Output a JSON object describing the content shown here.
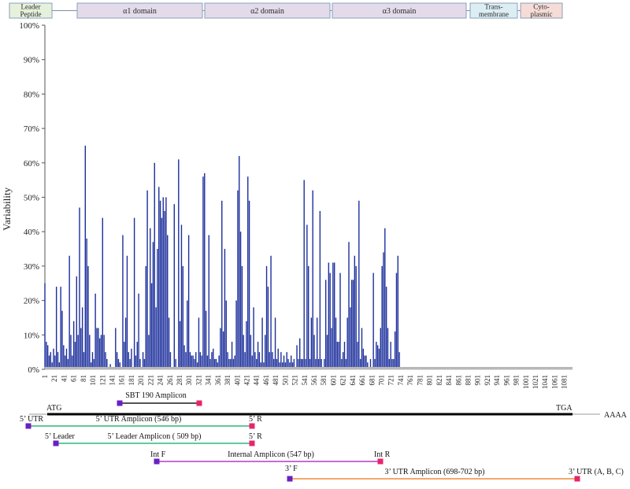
{
  "domains": [
    {
      "label": "Leader\nPeptide",
      "fill": "#e6f1dc"
    },
    {
      "label": "α1 domain",
      "fill": "#e3dbe9"
    },
    {
      "label": "α2 domain",
      "fill": "#e3dbe9"
    },
    {
      "label": "α3 domain",
      "fill": "#e3dbe9"
    },
    {
      "label": "Trans-\nmembrane",
      "fill": "#dceef4"
    },
    {
      "label": "Cyto-\nplasmic",
      "fill": "#f5dcd6"
    }
  ],
  "chart_data": {
    "type": "bar",
    "ylabel": "Variability",
    "xlabel": "",
    "ylim": [
      0,
      100
    ],
    "y_ticks": [
      "0%",
      "10%",
      "20%",
      "30%",
      "40%",
      "50%",
      "60%",
      "70%",
      "80%",
      "90%",
      "100%"
    ],
    "x_ticks": [
      "1",
      "21",
      "41",
      "61",
      "81",
      "101",
      "121",
      "141",
      "161",
      "181",
      "201",
      "221",
      "241",
      "261",
      "281",
      "301",
      "321",
      "341",
      "361",
      "381",
      "401",
      "421",
      "441",
      "461",
      "481",
      "501",
      "521",
      "541",
      "561",
      "581",
      "601",
      "621",
      "641",
      "661",
      "681",
      "701",
      "721",
      "741",
      "761",
      "781",
      "801",
      "821",
      "841",
      "861",
      "881",
      "901",
      "921",
      "941",
      "961",
      "981",
      "1001",
      "1021",
      "1041",
      "1061",
      "1081"
    ],
    "x_range": [
      1,
      1098
    ],
    "bar_color": "#1c2f9c",
    "points": [
      [
        1,
        25
      ],
      [
        4,
        8
      ],
      [
        7,
        7
      ],
      [
        10,
        4
      ],
      [
        13,
        5
      ],
      [
        16,
        2
      ],
      [
        19,
        6
      ],
      [
        22,
        4
      ],
      [
        25,
        24
      ],
      [
        28,
        5
      ],
      [
        31,
        2
      ],
      [
        34,
        24
      ],
      [
        37,
        17
      ],
      [
        40,
        7
      ],
      [
        43,
        4
      ],
      [
        46,
        6
      ],
      [
        49,
        3
      ],
      [
        52,
        33
      ],
      [
        55,
        10
      ],
      [
        58,
        4
      ],
      [
        61,
        14
      ],
      [
        64,
        8
      ],
      [
        67,
        27
      ],
      [
        70,
        10
      ],
      [
        73,
        47
      ],
      [
        76,
        12
      ],
      [
        79,
        18
      ],
      [
        82,
        5
      ],
      [
        85,
        65
      ],
      [
        88,
        38
      ],
      [
        91,
        30
      ],
      [
        94,
        10
      ],
      [
        97,
        2
      ],
      [
        100,
        5
      ],
      [
        103,
        3
      ],
      [
        106,
        22
      ],
      [
        109,
        12
      ],
      [
        112,
        12
      ],
      [
        115,
        9
      ],
      [
        118,
        10
      ],
      [
        121,
        44
      ],
      [
        124,
        10
      ],
      [
        127,
        5
      ],
      [
        130,
        3
      ],
      [
        137,
        1.5
      ],
      [
        148,
        12
      ],
      [
        151,
        5
      ],
      [
        154,
        3
      ],
      [
        157,
        2
      ],
      [
        163,
        39
      ],
      [
        166,
        8
      ],
      [
        169,
        15
      ],
      [
        172,
        33
      ],
      [
        175,
        5
      ],
      [
        178,
        3
      ],
      [
        181,
        6
      ],
      [
        187,
        44
      ],
      [
        190,
        4
      ],
      [
        193,
        8
      ],
      [
        196,
        22
      ],
      [
        199,
        3
      ],
      [
        205,
        5
      ],
      [
        208,
        3
      ],
      [
        211,
        30
      ],
      [
        214,
        52
      ],
      [
        217,
        10
      ],
      [
        220,
        41
      ],
      [
        223,
        25
      ],
      [
        226,
        37
      ],
      [
        229,
        60
      ],
      [
        232,
        18
      ],
      [
        235,
        35
      ],
      [
        238,
        53
      ],
      [
        241,
        49
      ],
      [
        244,
        44
      ],
      [
        247,
        50
      ],
      [
        250,
        46
      ],
      [
        253,
        50
      ],
      [
        256,
        39
      ],
      [
        259,
        15
      ],
      [
        262,
        5
      ],
      [
        270,
        48
      ],
      [
        273,
        3
      ],
      [
        279,
        61
      ],
      [
        282,
        14
      ],
      [
        285,
        42
      ],
      [
        288,
        30
      ],
      [
        291,
        7
      ],
      [
        294,
        5
      ],
      [
        297,
        20
      ],
      [
        300,
        39
      ],
      [
        303,
        5
      ],
      [
        306,
        4
      ],
      [
        309,
        4
      ],
      [
        312,
        3
      ],
      [
        315,
        5
      ],
      [
        318,
        2
      ],
      [
        321,
        15
      ],
      [
        324,
        5
      ],
      [
        327,
        4
      ],
      [
        330,
        56
      ],
      [
        333,
        57
      ],
      [
        336,
        17
      ],
      [
        339,
        4
      ],
      [
        342,
        39
      ],
      [
        345,
        3
      ],
      [
        348,
        5
      ],
      [
        351,
        6
      ],
      [
        354,
        3
      ],
      [
        357,
        3
      ],
      [
        360,
        2
      ],
      [
        363,
        4
      ],
      [
        366,
        12
      ],
      [
        369,
        49
      ],
      [
        372,
        11
      ],
      [
        375,
        35
      ],
      [
        378,
        20
      ],
      [
        381,
        5
      ],
      [
        384,
        3
      ],
      [
        387,
        3
      ],
      [
        390,
        8
      ],
      [
        393,
        3
      ],
      [
        396,
        4
      ],
      [
        399,
        20
      ],
      [
        402,
        52
      ],
      [
        405,
        62
      ],
      [
        408,
        40
      ],
      [
        411,
        30
      ],
      [
        414,
        10
      ],
      [
        417,
        5
      ],
      [
        420,
        14
      ],
      [
        423,
        56
      ],
      [
        426,
        49
      ],
      [
        429,
        10
      ],
      [
        432,
        4
      ],
      [
        435,
        18
      ],
      [
        438,
        5
      ],
      [
        441,
        3
      ],
      [
        444,
        8
      ],
      [
        447,
        5
      ],
      [
        450,
        2
      ],
      [
        453,
        15
      ],
      [
        456,
        2
      ],
      [
        459,
        10
      ],
      [
        462,
        30
      ],
      [
        465,
        24
      ],
      [
        468,
        5
      ],
      [
        471,
        33
      ],
      [
        474,
        5
      ],
      [
        477,
        3
      ],
      [
        480,
        15
      ],
      [
        483,
        3
      ],
      [
        486,
        6
      ],
      [
        489,
        2
      ],
      [
        492,
        5
      ],
      [
        495,
        2
      ],
      [
        498,
        4
      ],
      [
        501,
        2
      ],
      [
        504,
        5
      ],
      [
        507,
        3
      ],
      [
        510,
        2
      ],
      [
        513,
        4
      ],
      [
        516,
        2
      ],
      [
        519,
        3
      ],
      [
        525,
        7
      ],
      [
        528,
        3
      ],
      [
        531,
        9
      ],
      [
        534,
        3
      ],
      [
        537,
        3
      ],
      [
        540,
        55
      ],
      [
        543,
        3
      ],
      [
        546,
        42
      ],
      [
        549,
        30
      ],
      [
        552,
        3
      ],
      [
        555,
        15
      ],
      [
        558,
        52
      ],
      [
        561,
        10
      ],
      [
        564,
        3
      ],
      [
        567,
        15
      ],
      [
        570,
        3
      ],
      [
        573,
        46
      ],
      [
        576,
        3
      ],
      [
        582,
        3
      ],
      [
        585,
        26
      ],
      [
        588,
        10
      ],
      [
        591,
        31
      ],
      [
        594,
        28
      ],
      [
        597,
        12
      ],
      [
        600,
        31
      ],
      [
        603,
        31
      ],
      [
        606,
        15
      ],
      [
        609,
        8
      ],
      [
        612,
        8
      ],
      [
        615,
        28
      ],
      [
        618,
        3
      ],
      [
        621,
        5
      ],
      [
        624,
        8
      ],
      [
        627,
        3
      ],
      [
        630,
        15
      ],
      [
        633,
        37
      ],
      [
        636,
        18
      ],
      [
        639,
        26
      ],
      [
        642,
        26
      ],
      [
        645,
        33
      ],
      [
        648,
        30
      ],
      [
        651,
        8
      ],
      [
        654,
        49
      ],
      [
        657,
        3
      ],
      [
        660,
        12
      ],
      [
        663,
        6
      ],
      [
        666,
        4
      ],
      [
        669,
        4
      ],
      [
        672,
        2
      ],
      [
        678,
        3
      ],
      [
        684,
        28
      ],
      [
        687,
        3
      ],
      [
        690,
        8
      ],
      [
        693,
        7
      ],
      [
        696,
        6
      ],
      [
        699,
        12
      ],
      [
        702,
        30
      ],
      [
        705,
        34
      ],
      [
        708,
        41
      ],
      [
        711,
        24
      ],
      [
        714,
        12
      ],
      [
        717,
        3
      ],
      [
        720,
        8
      ],
      [
        723,
        3
      ],
      [
        726,
        3
      ],
      [
        729,
        11
      ],
      [
        732,
        28
      ],
      [
        735,
        33
      ],
      [
        738,
        5
      ]
    ]
  },
  "sequence": {
    "start_label": "ATG",
    "stop_label": "TGA",
    "poly_a_label": "AAAA"
  },
  "amplicons": [
    {
      "name": "SBT 190 Amplicon",
      "fwd_label": "",
      "rev_label": "",
      "line_color": "#1a1a1a",
      "row": 0
    },
    {
      "name": "5’ UTR Amplicon  (546 bp)",
      "fwd_label": "5’ UTR",
      "rev_label": "5’ R",
      "line_color": "#2db87a",
      "row": 1
    },
    {
      "name": "5’ Leader Amplicon ( 509 bp)",
      "fwd_label": "5’ Leader",
      "rev_label": "5’ R",
      "line_color": "#2db87a",
      "row": 2
    },
    {
      "name": "Internal Amplicon (547 bp)",
      "fwd_label": "Int F",
      "rev_label": "Int R",
      "line_color": "#b23cc8",
      "row": 3
    },
    {
      "name": "3’ UTR Amplicon (698-702 bp)",
      "fwd_label": "3’ F",
      "rev_label": "3’ UTR (A, B, C)",
      "line_color": "#f08a3c",
      "row": 4
    }
  ],
  "primer_colors": {
    "forward": "#6a1fc4",
    "reverse": "#e8246a"
  }
}
